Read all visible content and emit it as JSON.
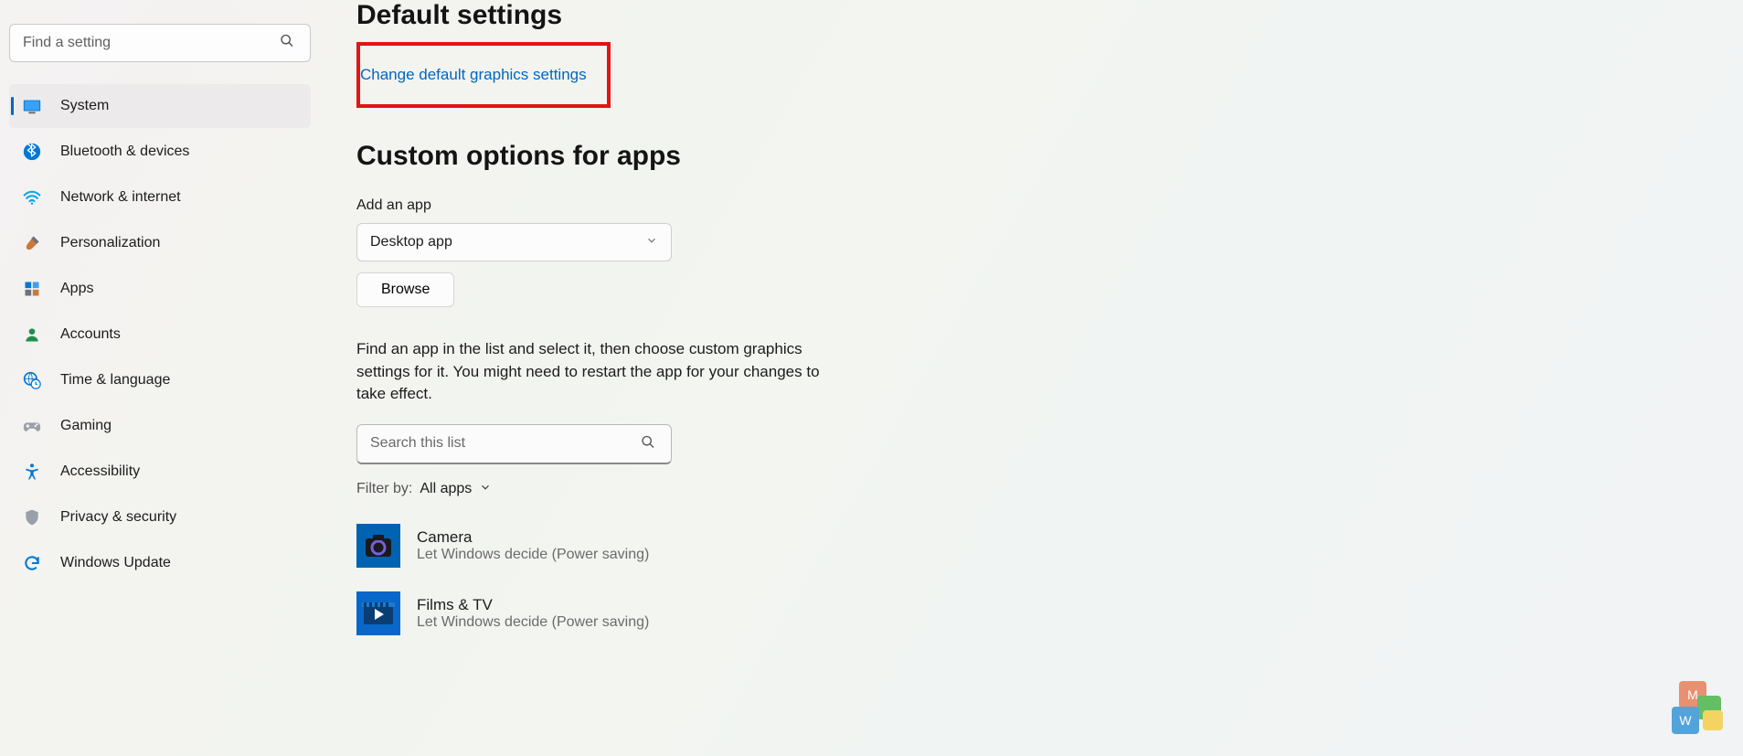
{
  "search": {
    "placeholder": "Find a setting"
  },
  "nav": [
    {
      "label": "System",
      "icon": "display",
      "active": true
    },
    {
      "label": "Bluetooth & devices",
      "icon": "bluetooth"
    },
    {
      "label": "Network & internet",
      "icon": "wifi"
    },
    {
      "label": "Personalization",
      "icon": "brush"
    },
    {
      "label": "Apps",
      "icon": "apps"
    },
    {
      "label": "Accounts",
      "icon": "person"
    },
    {
      "label": "Time & language",
      "icon": "globe-clock"
    },
    {
      "label": "Gaming",
      "icon": "gamepad"
    },
    {
      "label": "Accessibility",
      "icon": "accessibility"
    },
    {
      "label": "Privacy & security",
      "icon": "shield"
    },
    {
      "label": "Windows Update",
      "icon": "update"
    }
  ],
  "main": {
    "default_settings_title": "Default settings",
    "change_default_link": "Change default graphics settings",
    "custom_title": "Custom options for apps",
    "add_app_label": "Add an app",
    "select_value": "Desktop app",
    "browse_label": "Browse",
    "help_text": "Find an app in the list and select it, then choose custom graphics settings for it. You might need to restart the app for your changes to take effect.",
    "list_search_placeholder": "Search this list",
    "filter_label": "Filter by:",
    "filter_value": "All apps",
    "apps": [
      {
        "name": "Camera",
        "sub": "Let Windows decide (Power saving)",
        "icon": "camera"
      },
      {
        "name": "Films & TV",
        "sub": "Let Windows decide (Power saving)",
        "icon": "films"
      }
    ]
  },
  "watermark": {
    "m": "M",
    "w": "W"
  }
}
